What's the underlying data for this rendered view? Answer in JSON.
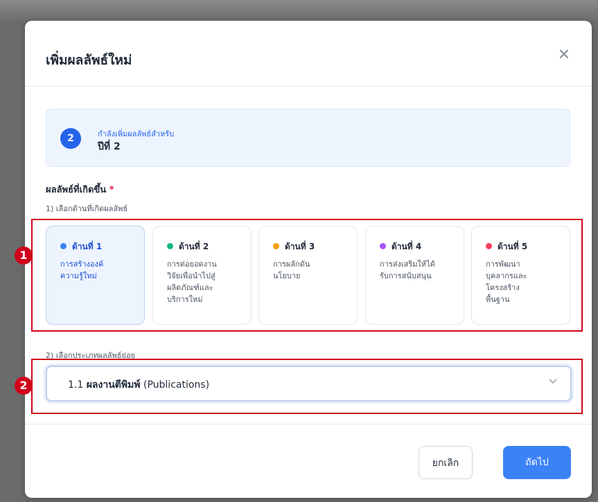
{
  "dialog": {
    "title": "เพิ่มผลลัพธ์ใหม่",
    "close_icon": "close-icon"
  },
  "year_info": {
    "badge": "2",
    "subtitle": "กำลังเพิ่มผลลัพธ์สำหรับ",
    "year": "ปีที่ 2",
    "color": "#2563eb"
  },
  "outcome": {
    "section_label": "ผลลัพธ์ที่เกิดขึ้น",
    "required_mark": "*",
    "step1_label": "1) เลือกด้านที่เกิดผลลัพธ์",
    "step2_label": "2) เลือกประเภทผลลัพธ์ย่อย",
    "cards": [
      {
        "title": "ด้านที่ 1",
        "desc": "การสร้างองค์\nความรู้ใหม่",
        "color": "#3b82f6",
        "selected": true
      },
      {
        "title": "ด้านที่ 2",
        "desc": "การต่อยอดงาน\nวิจัยเพื่อนำไปสู่\nผลิตภัณฑ์และ\nบริการใหม่",
        "color": "#10b981",
        "selected": false
      },
      {
        "title": "ด้านที่ 3",
        "desc": "การผลักดัน\nนโยบาย",
        "color": "#f59e0b",
        "selected": false
      },
      {
        "title": "ด้านที่ 4",
        "desc": "การส่งเสริมให้ได้\nรับการสนับสนุน",
        "color": "#a855f7",
        "selected": false
      },
      {
        "title": "ด้านที่ 5",
        "desc": "การพัฒนา\nบุคลากรและ\nโครงสร้าง\nพื้นฐาน",
        "color": "#f43f5e",
        "selected": false
      }
    ],
    "subtype_select": {
      "value_prefix": "1.1 ",
      "value_bold": "ผลงานตีพิมพ์",
      "value_suffix": " (Publications)"
    }
  },
  "annotations": {
    "first": "1",
    "second": "2",
    "color": "#d0021b"
  },
  "footer": {
    "cancel_label": "ยกเลิก",
    "next_label": "ถัดไป"
  }
}
